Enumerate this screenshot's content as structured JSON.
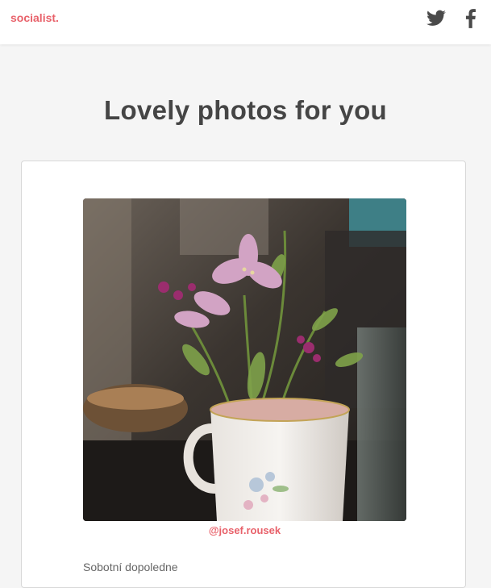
{
  "header": {
    "brand": "socialist.",
    "icons": [
      "twitter-icon",
      "facebook-icon"
    ]
  },
  "main": {
    "title": "Lovely photos for you"
  },
  "post": {
    "author": "@josef.rousek",
    "caption": "Sobotní dopoledne"
  },
  "colors": {
    "accent": "#e8616a",
    "title": "#454545",
    "icons": "#4a4a4a",
    "background": "#f5f5f5"
  }
}
